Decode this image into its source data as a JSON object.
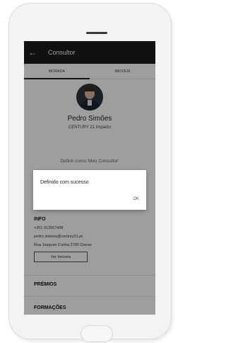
{
  "app_bar": {
    "title": "Consultor",
    "back_icon": "arrow-left-icon"
  },
  "tabs": [
    {
      "label": "MORADA",
      "active": true
    },
    {
      "label": "IMOVEIS",
      "active": false
    }
  ],
  "profile": {
    "name": "Pedro Simões",
    "agency": "CENTURY 21 Impacto"
  },
  "set_consultant_link": "Definir como 'Meu Consultor'",
  "info": {
    "title": "INFO",
    "phone": "+351 913567498",
    "email": "pedro.simoes@century21.pt",
    "address": "Rua Joaquim Cunha 2780 Oeiras",
    "button_label": "Ver Imóveis"
  },
  "sections": {
    "premios": "PRÉMIOS",
    "formacoes": "FORMAÇÕES"
  },
  "dialog": {
    "message": "Definido com sucesso",
    "ok_label": "OK"
  },
  "colors": {
    "app_bar": "#1a1a1a",
    "overlay": "rgba(0,0,0,0.38)"
  }
}
